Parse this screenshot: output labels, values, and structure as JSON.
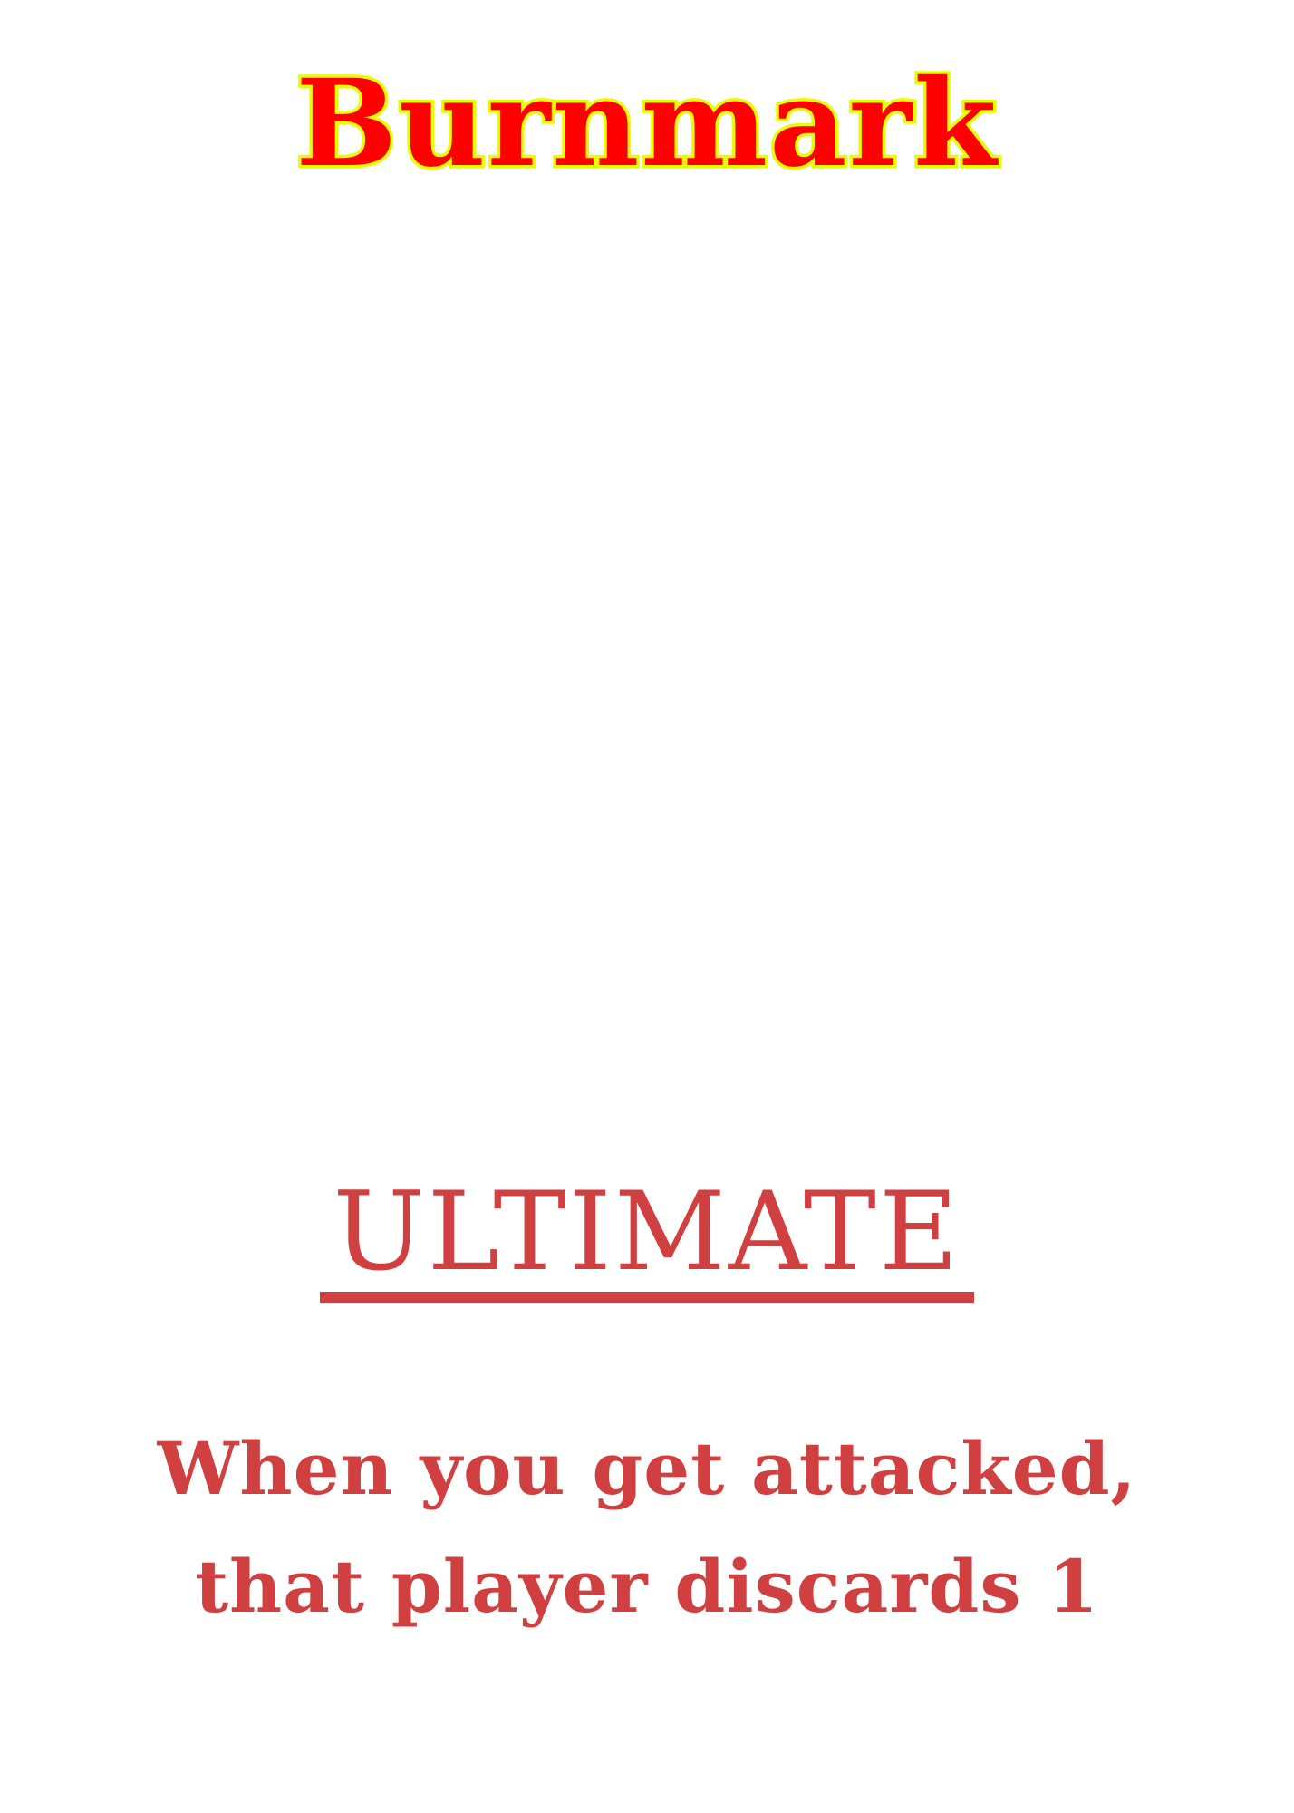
{
  "card": {
    "title": "Burnmark",
    "type_label": "ULTIMATE",
    "rules_text": "When you get attacked, that player discards 1"
  },
  "colors": {
    "title_fill": "#ff0000",
    "title_outline": "#e6ff00",
    "body_text": "#d04040",
    "background": "#ffffff"
  }
}
